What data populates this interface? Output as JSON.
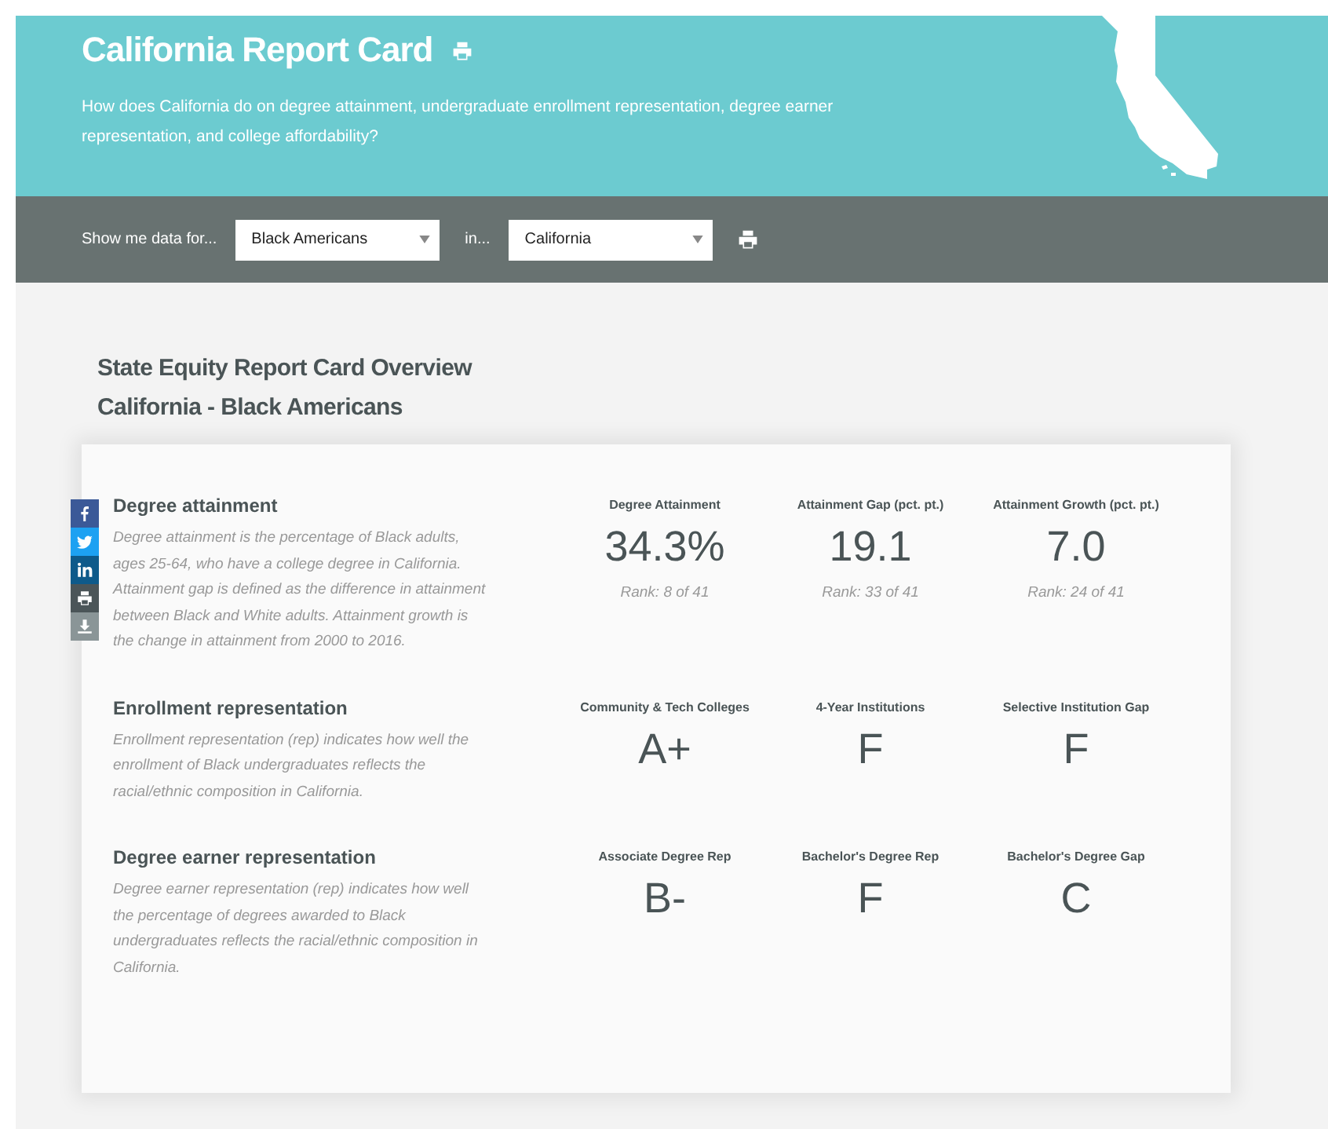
{
  "header": {
    "title": "California Report Card",
    "description": "How does California do on degree attainment, undergraduate enrollment representation, degree earner representation, and college affordability?"
  },
  "filters": [
    {
      "label": "Show me data for...",
      "value": "Black Americans"
    },
    {
      "label": "in...",
      "value": "California"
    }
  ],
  "overview": {
    "title": "State Equity Report Card Overview",
    "subtitle": "California - Black Americans"
  },
  "share_buttons": [
    {
      "kind": "facebook"
    },
    {
      "kind": "twitter"
    },
    {
      "kind": "linkedin"
    },
    {
      "kind": "print"
    },
    {
      "kind": "download"
    }
  ],
  "sections": [
    {
      "title": "Degree attainment",
      "description": "Degree attainment is the percentage of Black adults, ages 25-64, who have a college degree in California. Attainment gap is defined as the difference in attainment between Black and White adults. Attainment growth is the change in attainment from 2000 to 2016.",
      "metrics": [
        {
          "label": "Degree Attainment",
          "value": "34.3%",
          "rank": "Rank: 8 of 41"
        },
        {
          "label": "Attainment Gap (pct. pt.)",
          "value": "19.1",
          "rank": "Rank: 33 of 41"
        },
        {
          "label": "Attainment Growth (pct. pt.)",
          "value": "7.0",
          "rank": "Rank: 24 of 41"
        }
      ]
    },
    {
      "title": "Enrollment representation",
      "description": "Enrollment representation (rep) indicates how well the enrollment of Black undergraduates reflects the racial/ethnic composition in California.",
      "metrics": [
        {
          "label": "Community & Tech Colleges",
          "value": "A+"
        },
        {
          "label": "4-Year Institutions",
          "value": "F"
        },
        {
          "label": "Selective Institution Gap",
          "value": "F"
        }
      ]
    },
    {
      "title": "Degree earner representation",
      "description": "Degree earner representation (rep) indicates how well the percentage of degrees awarded to Black undergraduates reflects the racial/ethnic composition in California.",
      "metrics": [
        {
          "label": "Associate Degree Rep",
          "value": "B-"
        },
        {
          "label": "Bachelor's Degree Rep",
          "value": "F"
        },
        {
          "label": "Bachelor's Degree Gap",
          "value": "C"
        }
      ]
    }
  ]
}
